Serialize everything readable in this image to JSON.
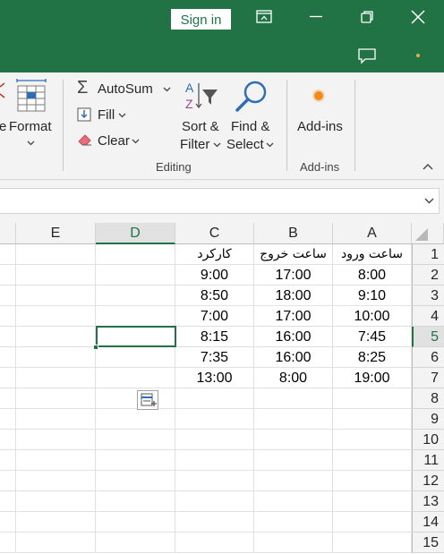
{
  "titlebar": {
    "signin_label": "Sign in",
    "icons": [
      "ribbon-display-icon",
      "minimize-icon",
      "restore-icon",
      "close-icon",
      "comments-icon",
      "notification-dot-icon"
    ]
  },
  "ribbon": {
    "format_partial_label": "e",
    "format_label": "Format",
    "autosum_label": "AutoSum",
    "fill_label": "Fill",
    "clear_label": "Clear",
    "sort_label": "Sort &",
    "filter_label": "Filter",
    "find_label": "Find &",
    "select_label": "Select",
    "addins_label": "Add-ins",
    "editing_group": "Editing",
    "addins_group": "Add-ins"
  },
  "grid": {
    "columns": [
      "E",
      "D",
      "C",
      "B",
      "A"
    ],
    "selected_column": "D",
    "rows": [
      "1",
      "2",
      "3",
      "4",
      "5",
      "6",
      "7",
      "8",
      "9",
      "10",
      "11",
      "12",
      "13",
      "14",
      "15"
    ],
    "selected_row": "5",
    "data": [
      {
        "A": "ساعت ورود",
        "B": "ساعت خروج",
        "C": "کارکرد"
      },
      {
        "A": "8:00",
        "B": "17:00",
        "C": "9:00"
      },
      {
        "A": "9:10",
        "B": "18:00",
        "C": "8:50"
      },
      {
        "A": "10:00",
        "B": "17:00",
        "C": "7:00"
      },
      {
        "A": "7:45",
        "B": "16:00",
        "C": "8:15"
      },
      {
        "A": "8:25",
        "B": "16:00",
        "C": "7:35"
      },
      {
        "A": "19:00",
        "B": "8:00",
        "C": "13:00"
      }
    ]
  }
}
